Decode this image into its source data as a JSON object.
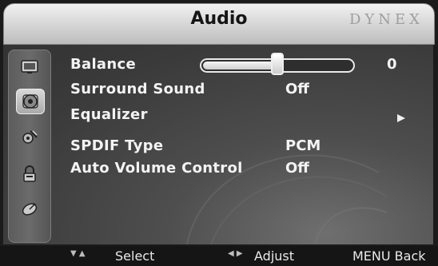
{
  "header": {
    "title": "Audio",
    "brand": "DYNEX"
  },
  "sidebar": {
    "items": [
      {
        "name": "tv-icon",
        "active": false
      },
      {
        "name": "audio-icon",
        "active": true
      },
      {
        "name": "settings-icon",
        "active": false
      },
      {
        "name": "lock-icon",
        "active": false
      },
      {
        "name": "dish-icon",
        "active": false
      }
    ]
  },
  "menu": {
    "balance": {
      "label": "Balance",
      "value": "0",
      "slider_level": 0.5
    },
    "surround": {
      "label": "Surround Sound",
      "value": "Off"
    },
    "equalizer": {
      "label": "Equalizer"
    },
    "spdif": {
      "label": "SPDIF Type",
      "value": "PCM"
    },
    "avc": {
      "label": "Auto Volume Control",
      "value": "Off"
    }
  },
  "footer": {
    "select_label": "Select",
    "adjust_label": "Adjust",
    "back_label": "MENU Back"
  },
  "colors": {
    "text": "#f3f3f3",
    "panel": "#4a4a4a",
    "header": "#d9d9d9"
  }
}
